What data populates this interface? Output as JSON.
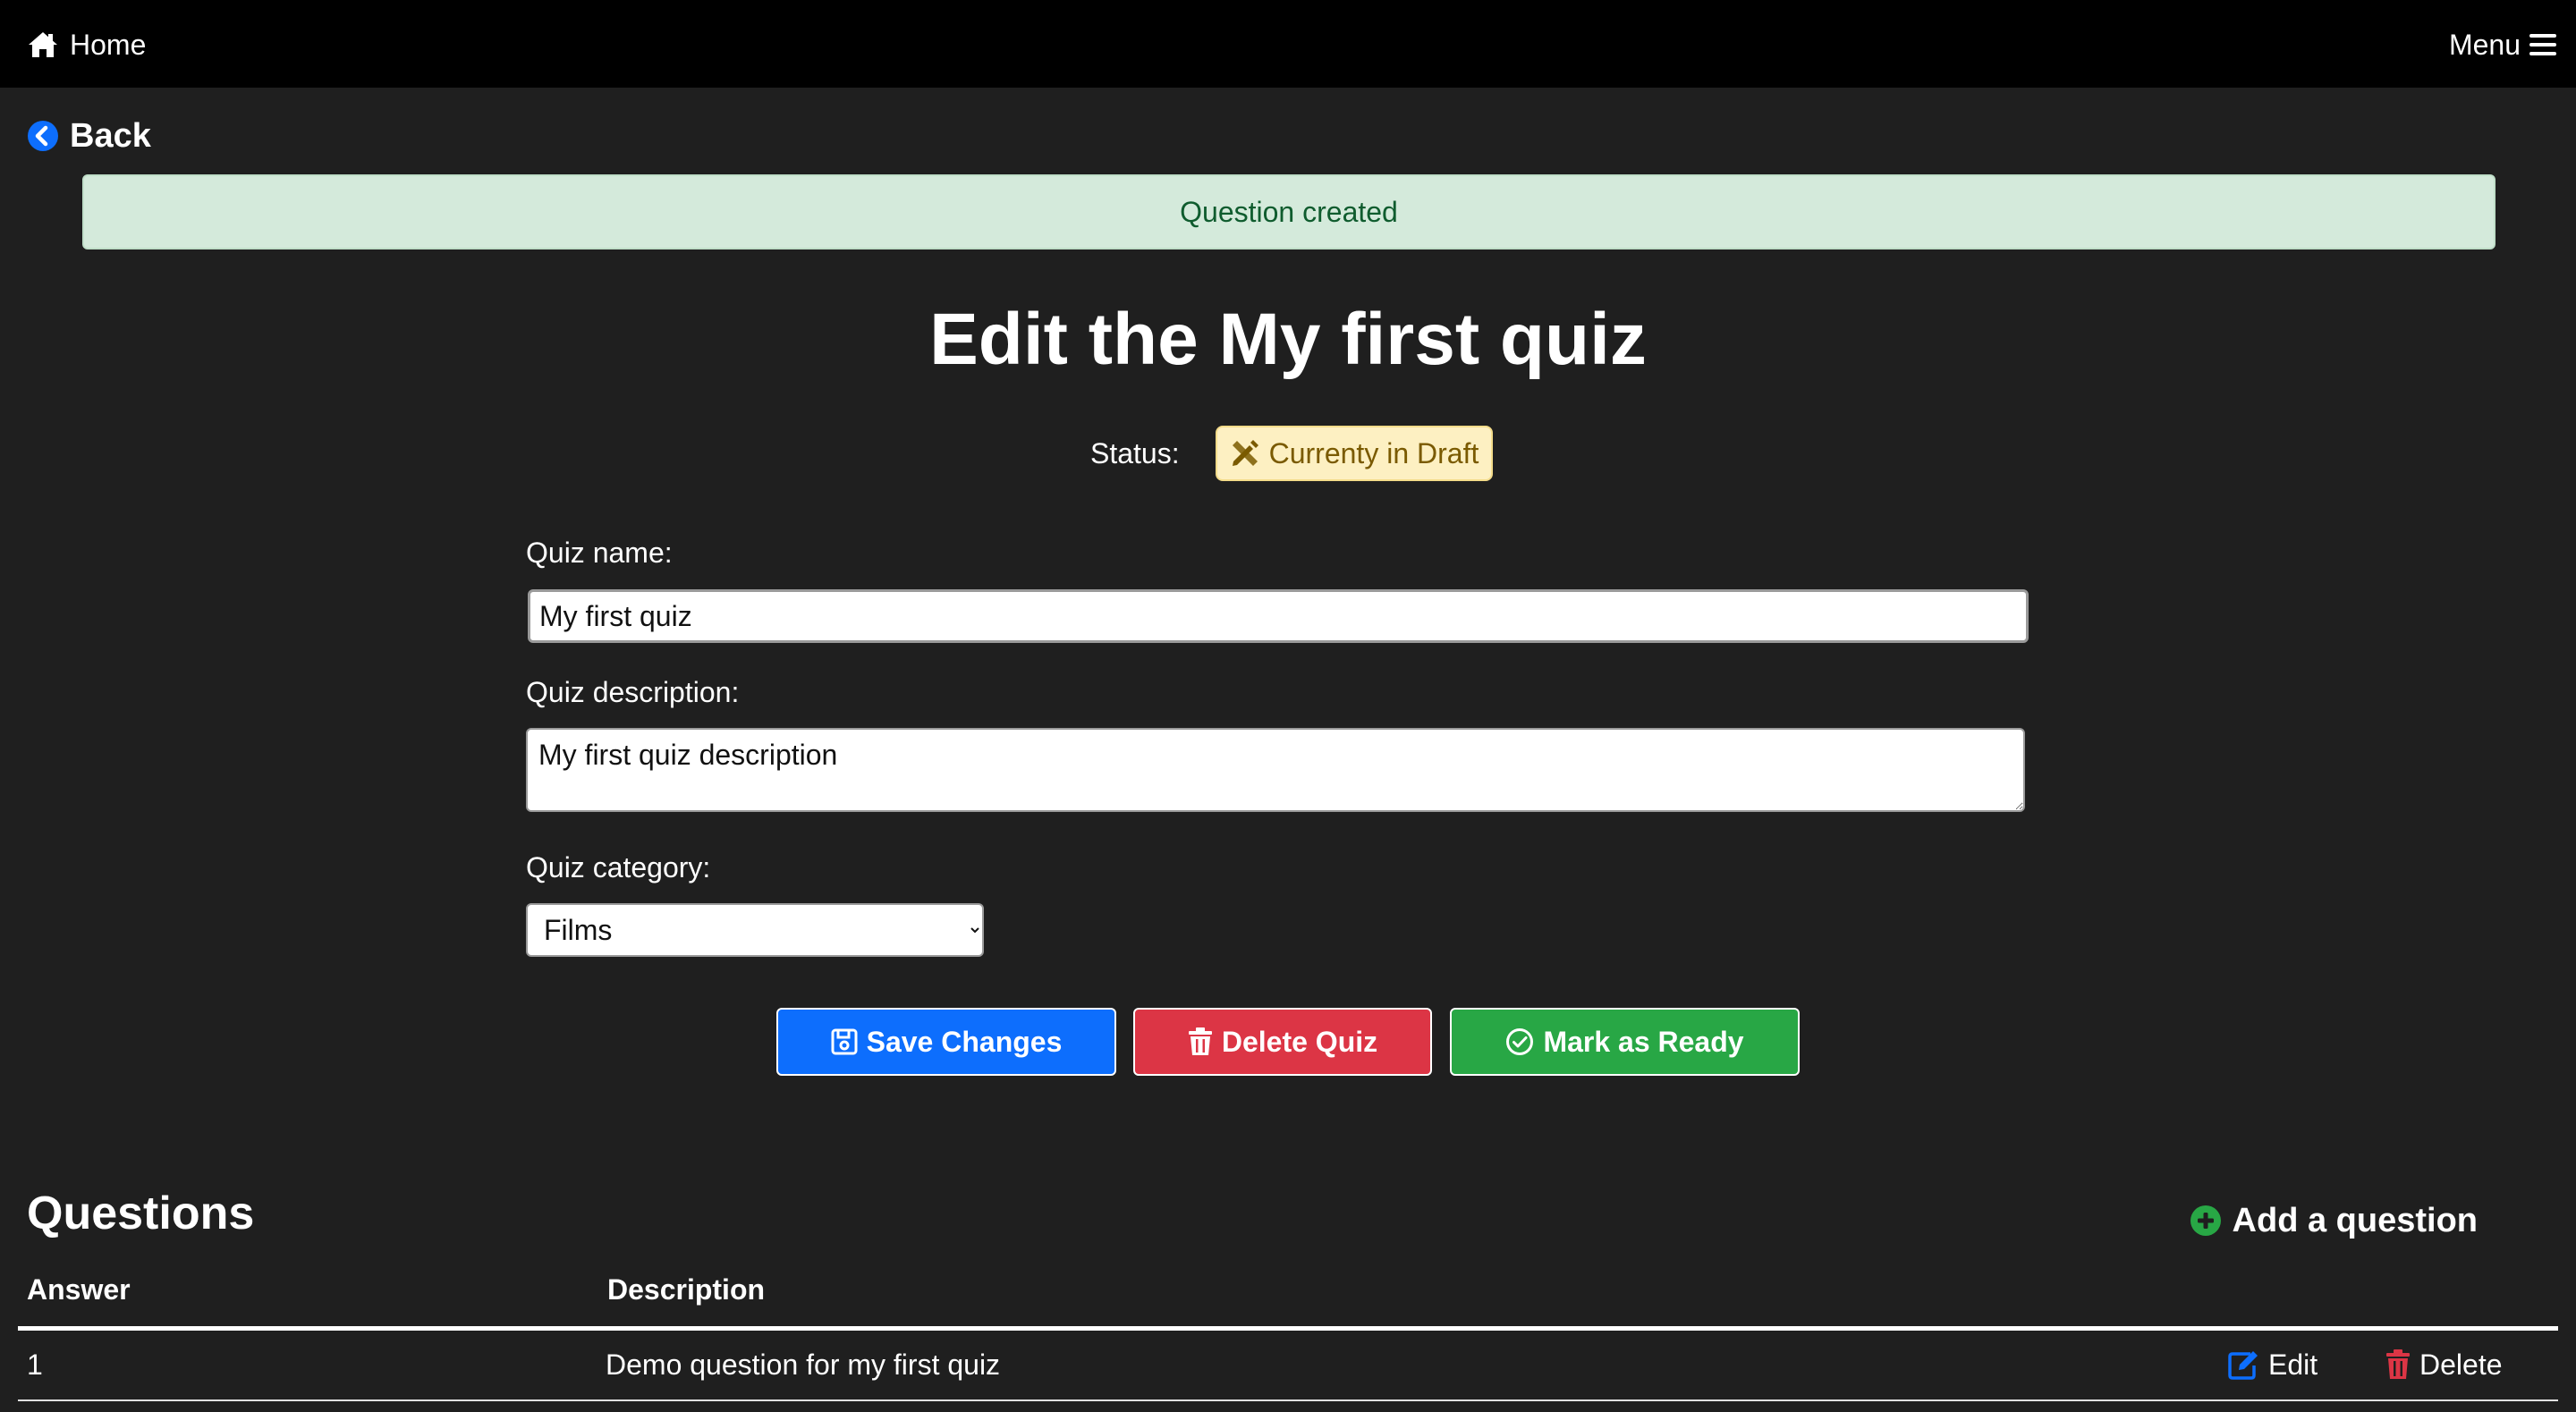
{
  "nav": {
    "home_label": "Home",
    "menu_label": "Menu"
  },
  "back_label": "Back",
  "alert_text": "Question created",
  "page_title": "Edit the My first quiz",
  "status": {
    "label": "Status:",
    "badge": "Currenty in Draft"
  },
  "form": {
    "name_label": "Quiz name:",
    "name_value": "My first quiz",
    "description_label": "Quiz description:",
    "description_value": "My first quiz description",
    "category_label": "Quiz category:",
    "category_value": "Films"
  },
  "buttons": {
    "save": "Save Changes",
    "delete": "Delete Quiz",
    "ready": "Mark as Ready"
  },
  "questions": {
    "title": "Questions",
    "add_label": "Add a question",
    "columns": [
      "Answer",
      "Description"
    ],
    "rows": [
      {
        "answer": "1",
        "description": "Demo question for my first quiz",
        "edit_label": "Edit",
        "delete_label": "Delete"
      }
    ]
  },
  "colors": {
    "background": "#1f1f1f",
    "navbar": "#000000",
    "alert_bg": "#d4eadb",
    "badge_bg": "#fdf0c2",
    "primary": "#0d6efd",
    "danger": "#dc3545",
    "success": "#28a745"
  },
  "icons": {
    "home": "home-icon",
    "menu": "hamburger-icon",
    "back": "chevron-circle-left-icon",
    "status": "pencil-ruler-icon",
    "save": "floppy-disk-icon",
    "delete": "trash-icon",
    "ready": "check-circle-icon",
    "add": "plus-circle-icon",
    "edit": "edit-icon"
  }
}
